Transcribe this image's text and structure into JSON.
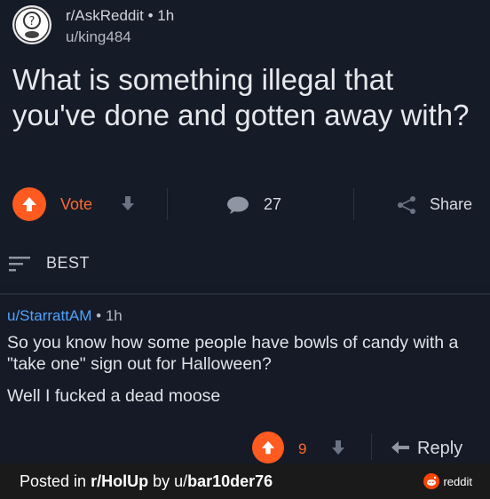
{
  "post": {
    "subreddit": "r/AskReddit",
    "separator": "•",
    "age": "1h",
    "author": "u/king484",
    "title": "What is something illegal that you've done and gotten away with?",
    "vote_label": "Vote",
    "comment_count": "27",
    "share_label": "Share"
  },
  "sort": {
    "label": "BEST"
  },
  "comment": {
    "author": "u/StarrattAM",
    "separator": "•",
    "age": "1h",
    "paragraphs": [
      "So you know how some people have bowls of candy with a \"take one\" sign out for Halloween?",
      "Well I fucked a dead moose"
    ],
    "score": "9",
    "reply_label": "Reply"
  },
  "footer": {
    "prefix": "Posted in ",
    "subreddit": "r/HolUp",
    "by": " by ",
    "user_prefix": "u/",
    "username": "bar10der76",
    "brand": "reddit"
  },
  "colors": {
    "upvote": "#ff5a1f",
    "accent_text": "#ff6a2c",
    "link": "#4fa3ff",
    "background": "#161b28",
    "footer": "#1a1a1b"
  },
  "icons": [
    "subreddit-avatar-icon",
    "upvote-icon",
    "downvote-icon",
    "comment-icon",
    "share-icon",
    "sort-icon",
    "reply-icon",
    "reddit-logo-icon"
  ]
}
